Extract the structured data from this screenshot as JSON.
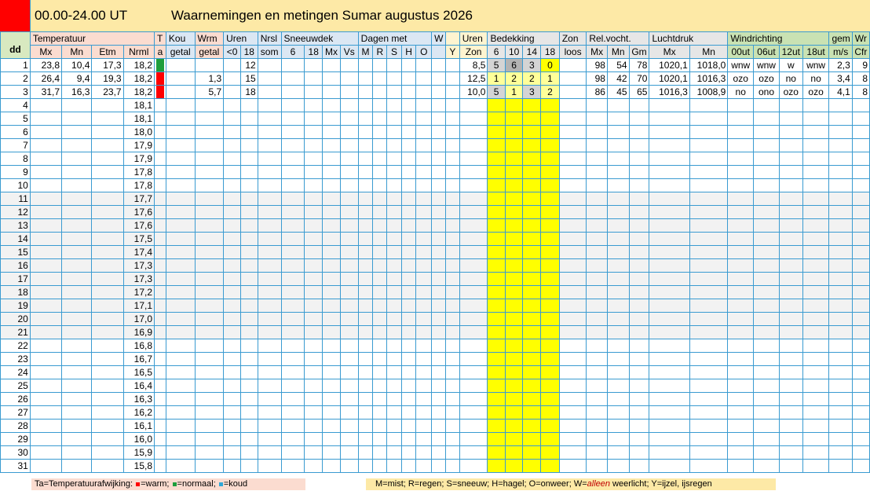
{
  "header": {
    "time_range": "00.00-24.00 UT",
    "title": "Waarnemingen en metingen Sumar augustus 2026"
  },
  "colors": {
    "warm": "#ff0000",
    "normaal": "#1e9e3c",
    "koud": "#2fa8d8",
    "accent_bar": "#ff0000"
  },
  "groups": {
    "dd": "dd",
    "temperatuur": "Temperatuur",
    "t": "T",
    "kou": "Kou",
    "wrm": "Wrm",
    "uren": "Uren",
    "nrsl": "Nrsl",
    "sneeuwdek": "Sneeuwdek",
    "dagen_met": "Dagen met",
    "w": "W",
    "uren_zon": "Uren",
    "bedekking": "Bedekking",
    "zon": "Zon",
    "relvocht": "Rel.vocht.",
    "luchtdruk": "Luchtdruk",
    "windrichting": "Windrichting",
    "gem": "gem",
    "wr": "Wr"
  },
  "sub": {
    "mx": "Mx",
    "mn": "Mn",
    "etm": "Etm",
    "nrml": "Nrml",
    "a": "a",
    "getal_k": "getal",
    "getal_w": "getal",
    "lt0": "<0",
    "u18": "18",
    "som": "som",
    "s6": "6",
    "s18": "18",
    "smx": "Mx",
    "svs": "Vs",
    "m": "M",
    "rr": "R",
    "s": "S",
    "h": "H",
    "o": "O",
    "y": "Y",
    "zon": "Zon",
    "b6": "6",
    "b10": "10",
    "b14": "14",
    "b18": "18",
    "loos": "loos",
    "rmx": "Mx",
    "rmn": "Mn",
    "rgm": "Gm",
    "lmx": "Mx",
    "lmn": "Mn",
    "w00": "00ut",
    "w06": "06ut",
    "w12": "12ut",
    "w18": "18ut",
    "ms": "m/s",
    "cfr": "Cfr"
  },
  "normals": [
    "18,2",
    "18,2",
    "18,2",
    "18,1",
    "18,1",
    "18,0",
    "17,9",
    "17,9",
    "17,8",
    "17,8",
    "17,7",
    "17,6",
    "17,6",
    "17,5",
    "17,4",
    "17,3",
    "17,3",
    "17,2",
    "17,1",
    "17,0",
    "16,9",
    "16,8",
    "16,7",
    "16,5",
    "16,4",
    "16,3",
    "16,2",
    "16,1",
    "16,0",
    "15,9",
    "15,8"
  ],
  "rows": [
    {
      "dd": "1",
      "mx": "23,8",
      "mn": "10,4",
      "etm": "17,3",
      "ta": "normaal",
      "wrm": "",
      "u18": "12",
      "zon": "8,5",
      "b6": "5",
      "b10": "6",
      "b14": "3",
      "b18": "0",
      "rmx": "98",
      "rmn": "54",
      "rgm": "78",
      "lmx": "1020,1",
      "lmn": "1018,0",
      "w00": "wnw",
      "w06": "wnw",
      "w12": "w",
      "w18": "wnw",
      "ms": "2,3",
      "cfr": "9"
    },
    {
      "dd": "2",
      "mx": "26,4",
      "mn": "9,4",
      "etm": "19,3",
      "ta": "warm",
      "wrm": "1,3",
      "u18": "15",
      "zon": "12,5",
      "b6": "1",
      "b10": "2",
      "b14": "2",
      "b18": "1",
      "rmx": "98",
      "rmn": "42",
      "rgm": "70",
      "lmx": "1020,1",
      "lmn": "1016,3",
      "w00": "ozo",
      "w06": "ozo",
      "w12": "no",
      "w18": "no",
      "ms": "3,4",
      "cfr": "8"
    },
    {
      "dd": "3",
      "mx": "31,7",
      "mn": "16,3",
      "etm": "23,7",
      "ta": "warm",
      "wrm": "5,7",
      "u18": "18",
      "zon": "10,0",
      "b6": "5",
      "b10": "1",
      "b14": "3",
      "b18": "2",
      "rmx": "86",
      "rmn": "45",
      "rgm": "65",
      "lmx": "1016,3",
      "lmn": "1008,9",
      "w00": "no",
      "w06": "ono",
      "w12": "ozo",
      "w18": "ozo",
      "ms": "4,1",
      "cfr": "8"
    }
  ],
  "legend_ta": {
    "lead": "Ta=Temperatuurafwijking: ",
    "warm": "=warm; ",
    "normaal": "=normaal; ",
    "koud": "=koud"
  },
  "legend_dagen": {
    "pre": "M=mist; R=regen; S=sneeuw; H=hagel; O=onweer; W=",
    "alleen": "alleen",
    "post": " weerlicht; Y=ijzel, ijsregen"
  }
}
